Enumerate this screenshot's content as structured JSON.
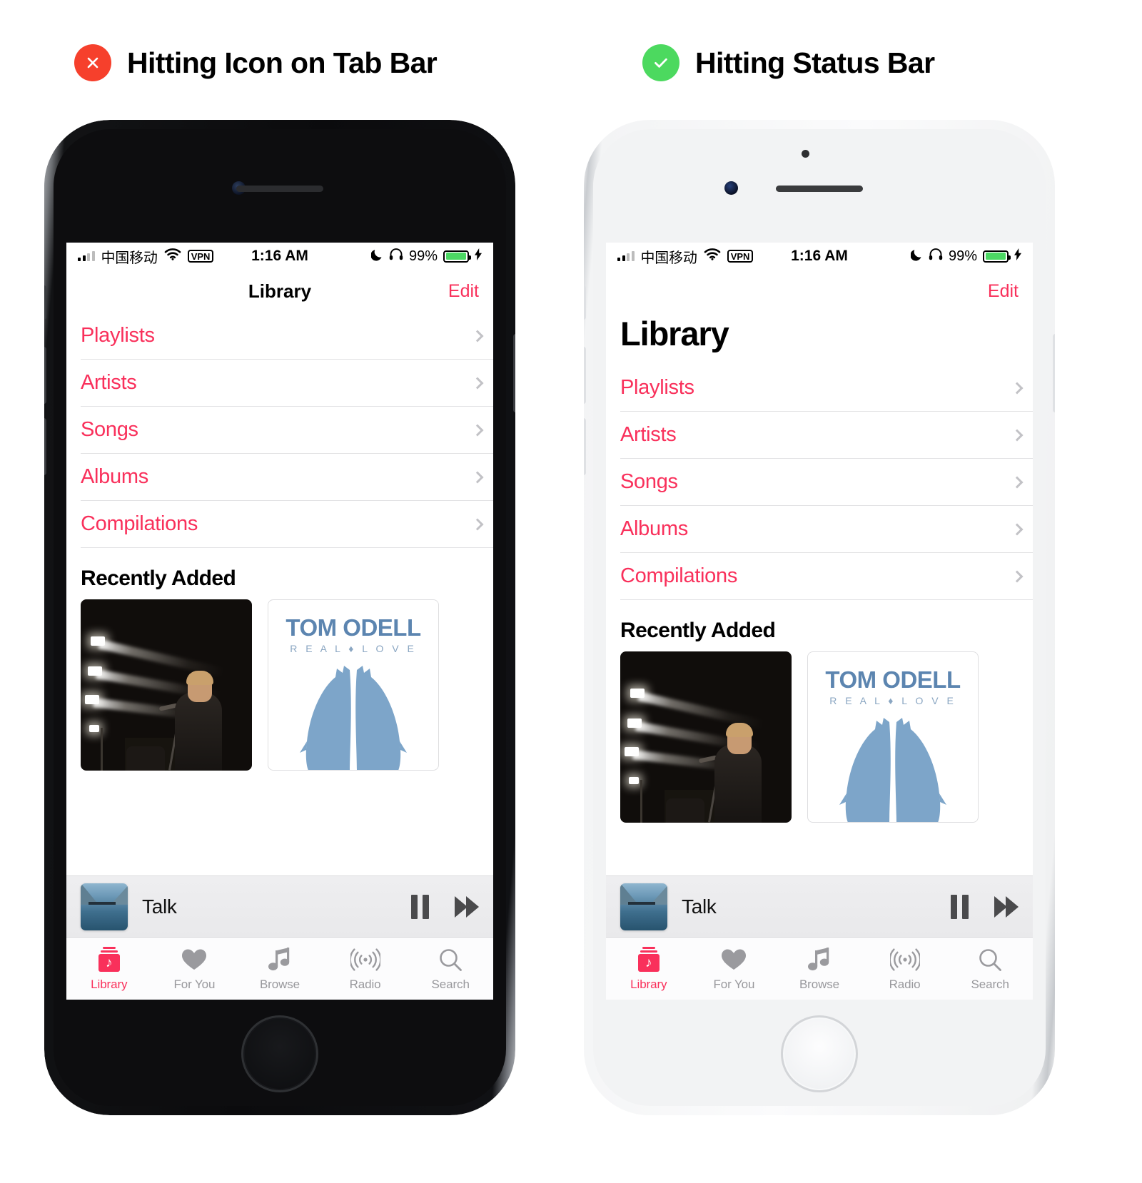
{
  "captions": {
    "left": {
      "badge": "x-circle-icon",
      "text": "Hitting Icon on Tab Bar"
    },
    "right": {
      "badge": "check-circle-icon",
      "text": "Hitting Status Bar"
    }
  },
  "colors": {
    "accent_red": "#F9305B",
    "bad_badge": "#F6402C",
    "good_badge": "#4CD95F",
    "battery_green": "#4CD964",
    "tab_inactive": "#98989C"
  },
  "status_bar": {
    "signal_icon": "cellular-bars-icon",
    "carrier": "中国移动",
    "wifi_icon": "wifi-icon",
    "vpn_label": "VPN",
    "time": "1:16 AM",
    "dnd_icon": "moon-icon",
    "headphones_icon": "headphones-icon",
    "battery_percent": "99%",
    "battery_icon": "battery-icon",
    "charging_icon": "lightning-bolt-icon"
  },
  "nav": {
    "title": "Library",
    "edit_label": "Edit"
  },
  "library_rows": [
    {
      "label": "Playlists"
    },
    {
      "label": "Artists"
    },
    {
      "label": "Songs"
    },
    {
      "label": "Albums"
    },
    {
      "label": "Compilations"
    }
  ],
  "recently_added": {
    "heading": "Recently Added",
    "albums": [
      {
        "name": "concert-live-album",
        "title": "",
        "subtitle": ""
      },
      {
        "name": "tom-odell-real-love",
        "title": "TOM ODELL",
        "subtitle": "R E A L ♦ L O V E"
      }
    ]
  },
  "mini_player": {
    "artwork": "lake-mountain-artwork",
    "track_title": "Talk",
    "pause_icon": "pause-icon",
    "forward_icon": "fast-forward-icon"
  },
  "tab_bar": {
    "items": [
      {
        "label": "Library",
        "icon": "library-icon",
        "active": true
      },
      {
        "label": "For You",
        "icon": "heart-icon",
        "active": false
      },
      {
        "label": "Browse",
        "icon": "music-note-icon",
        "active": false
      },
      {
        "label": "Radio",
        "icon": "radio-waves-icon",
        "active": false
      },
      {
        "label": "Search",
        "icon": "search-icon",
        "active": false
      }
    ]
  }
}
